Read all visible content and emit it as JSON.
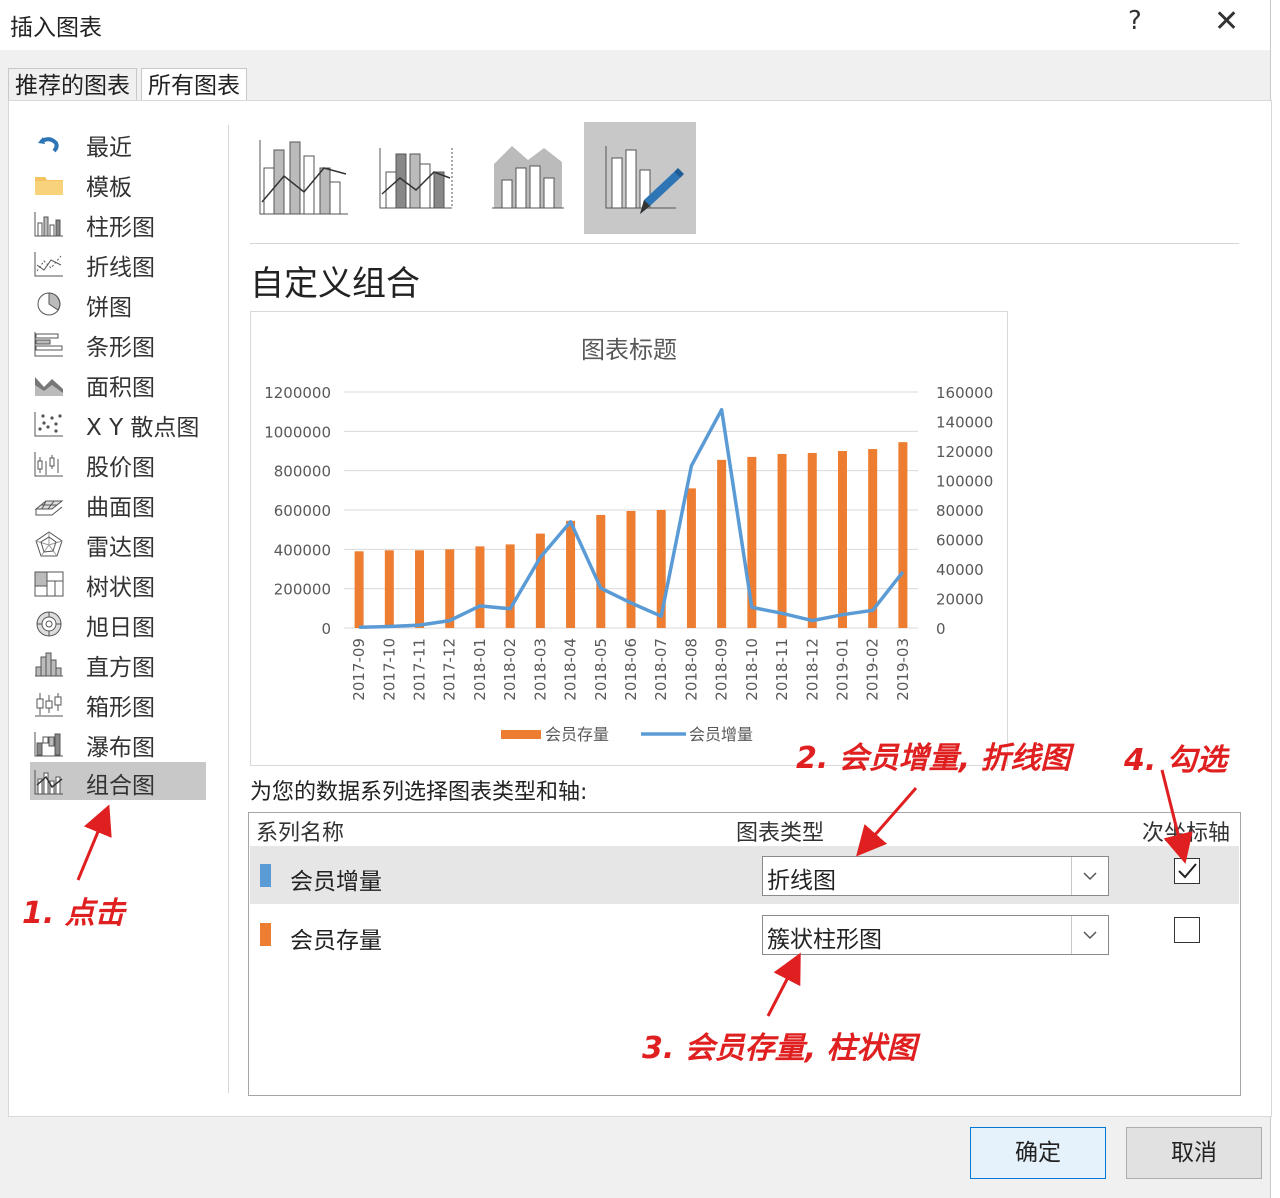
{
  "window": {
    "title": "插入图表",
    "help_label": "?",
    "close_label": "✕"
  },
  "tabs": [
    {
      "label": "推荐的图表",
      "active": false
    },
    {
      "label": "所有图表",
      "active": true
    }
  ],
  "sidebar": {
    "selected": "组合图",
    "items": [
      {
        "label": "最近",
        "icon": "undo-icon"
      },
      {
        "label": "模板",
        "icon": "folder-icon"
      },
      {
        "label": "柱形图",
        "icon": "column-chart-icon"
      },
      {
        "label": "折线图",
        "icon": "line-chart-icon"
      },
      {
        "label": "饼图",
        "icon": "pie-chart-icon"
      },
      {
        "label": "条形图",
        "icon": "bar-chart-icon"
      },
      {
        "label": "面积图",
        "icon": "area-chart-icon"
      },
      {
        "label": "X Y 散点图",
        "icon": "scatter-chart-icon"
      },
      {
        "label": "股价图",
        "icon": "stock-chart-icon"
      },
      {
        "label": "曲面图",
        "icon": "surface-chart-icon"
      },
      {
        "label": "雷达图",
        "icon": "radar-chart-icon"
      },
      {
        "label": "树状图",
        "icon": "treemap-icon"
      },
      {
        "label": "旭日图",
        "icon": "sunburst-icon"
      },
      {
        "label": "直方图",
        "icon": "histogram-icon"
      },
      {
        "label": "箱形图",
        "icon": "box-whisker-icon"
      },
      {
        "label": "瀑布图",
        "icon": "waterfall-icon"
      },
      {
        "label": "组合图",
        "icon": "combo-chart-icon"
      }
    ]
  },
  "subtypes": {
    "selected_index": 3,
    "icons": [
      "clustered-column-line-icon",
      "clustered-column-line-secondary-icon",
      "stacked-area-column-icon",
      "custom-combination-icon"
    ]
  },
  "section_title": "自定义组合",
  "chart_data": {
    "type": "bar",
    "title": "图表标题",
    "categories": [
      "2017-09",
      "2017-10",
      "2017-11",
      "2017-12",
      "2018-01",
      "2018-02",
      "2018-03",
      "2018-04",
      "2018-05",
      "2018-06",
      "2018-07",
      "2018-08",
      "2018-09",
      "2018-10",
      "2018-11",
      "2018-12",
      "2019-01",
      "2019-02",
      "2019-03"
    ],
    "series": [
      {
        "name": "会员存量",
        "kind": "bar",
        "axis": "primary",
        "color": "#ed7d31",
        "values": [
          390000,
          395000,
          395000,
          400000,
          415000,
          425000,
          480000,
          545000,
          575000,
          595000,
          600000,
          710000,
          855000,
          870000,
          885000,
          890000,
          900000,
          910000,
          945000
        ]
      },
      {
        "name": "会员增量",
        "kind": "line",
        "axis": "secondary",
        "color": "#5b9bd5",
        "values": [
          500,
          1000,
          2000,
          5000,
          15000,
          13000,
          48000,
          72000,
          27000,
          17000,
          8000,
          110000,
          148000,
          14000,
          10000,
          5000,
          9000,
          12000,
          38000
        ]
      }
    ],
    "ylim": [
      0,
      1200000
    ],
    "y2lim": [
      0,
      160000
    ],
    "yticks": [
      "1200000",
      "1000000",
      "800000",
      "600000",
      "400000",
      "200000",
      "0"
    ],
    "y2ticks": [
      "160000",
      "140000",
      "120000",
      "100000",
      "80000",
      "60000",
      "40000",
      "20000",
      "0"
    ],
    "legend": "bottom",
    "grid": true
  },
  "series_prompt": "为您的数据系列选择图表类型和轴:",
  "grid_headers": {
    "name": "系列名称",
    "type": "图表类型",
    "secondary": "次坐标轴"
  },
  "rows": [
    {
      "name": "会员增量",
      "color": "#5b9bd5",
      "chart_type": "折线图",
      "secondary_axis": true
    },
    {
      "name": "会员存量",
      "color": "#ed7d31",
      "chart_type": "簇状柱形图",
      "secondary_axis": false
    }
  ],
  "buttons": {
    "ok": "确定",
    "cancel": "取消"
  },
  "annotations": {
    "a1": "1. 点击",
    "a2": "2. 会员增量, 折线图",
    "a3": "3. 会员存量, 柱状图",
    "a4": "4. 勾选"
  }
}
